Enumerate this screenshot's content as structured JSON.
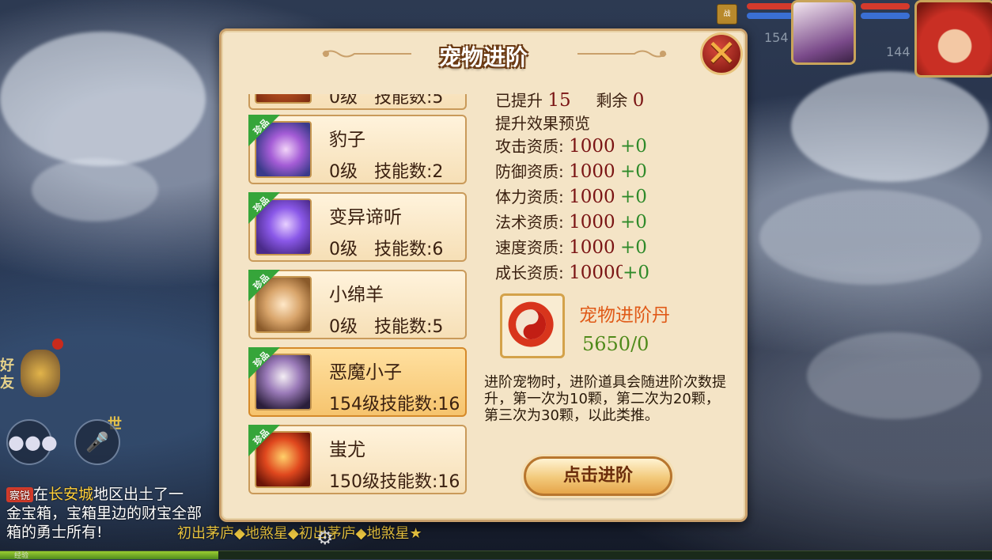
{
  "hud": {
    "buff_label": "战",
    "team_hp_1": "154",
    "team_hp_2": "144"
  },
  "left_hud": {
    "friend_label": "好友",
    "world_badge": "世"
  },
  "chat": {
    "line1_prefix": "在",
    "line1_tag": "察锐",
    "line1_place": "长安城",
    "line1_rest": "地区出土了一",
    "line2": "金宝箱，宝箱里边的财宝全部",
    "line3": "箱的勇士所有!",
    "marquee": "初出茅庐◆地煞星◆初出茅庐◆地煞星★",
    "exp_label": "经验"
  },
  "panel": {
    "title": "宠物进阶",
    "close_glyph": "✕"
  },
  "pets": [
    {
      "badge": "珍品",
      "name": "",
      "level": "0级",
      "skills": "技能数:5"
    },
    {
      "badge": "珍品",
      "name": "豹子",
      "level": "0级",
      "skills": "技能数:2"
    },
    {
      "badge": "珍品",
      "name": "变异谛听",
      "level": "0级",
      "skills": "技能数:6"
    },
    {
      "badge": "珍品",
      "name": "小绵羊",
      "level": "0级",
      "skills": "技能数:5"
    },
    {
      "badge": "珍品",
      "name": "恶魔小子",
      "level": "154级",
      "skills": "技能数:16"
    },
    {
      "badge": "珍品",
      "name": "蚩尤",
      "level": "150级",
      "skills": "技能数:16"
    }
  ],
  "upgrade": {
    "raised_label": "已提升",
    "raised_value": "15",
    "remain_label": "剩余",
    "remain_value": "0",
    "preview_label": "提升效果预览"
  },
  "stats": [
    {
      "label": "攻击资质:",
      "value": "1000",
      "bonus": "+0"
    },
    {
      "label": "防御资质:",
      "value": "1000",
      "bonus": "+0"
    },
    {
      "label": "体力资质:",
      "value": "1000",
      "bonus": "+0"
    },
    {
      "label": "法术资质:",
      "value": "1000",
      "bonus": "+0"
    },
    {
      "label": "速度资质:",
      "value": "1000",
      "bonus": "+0"
    },
    {
      "label": "成长资质:",
      "value": "10000",
      "bonus": "+0"
    }
  ],
  "item": {
    "name": "宠物进阶丹",
    "count": "5650/0"
  },
  "description": "进阶宠物时，进阶道具会随进阶次数提升，第一次为10颗，第二次为20颗，第三次为30颗，以此类推。",
  "action_button": "点击进阶"
}
